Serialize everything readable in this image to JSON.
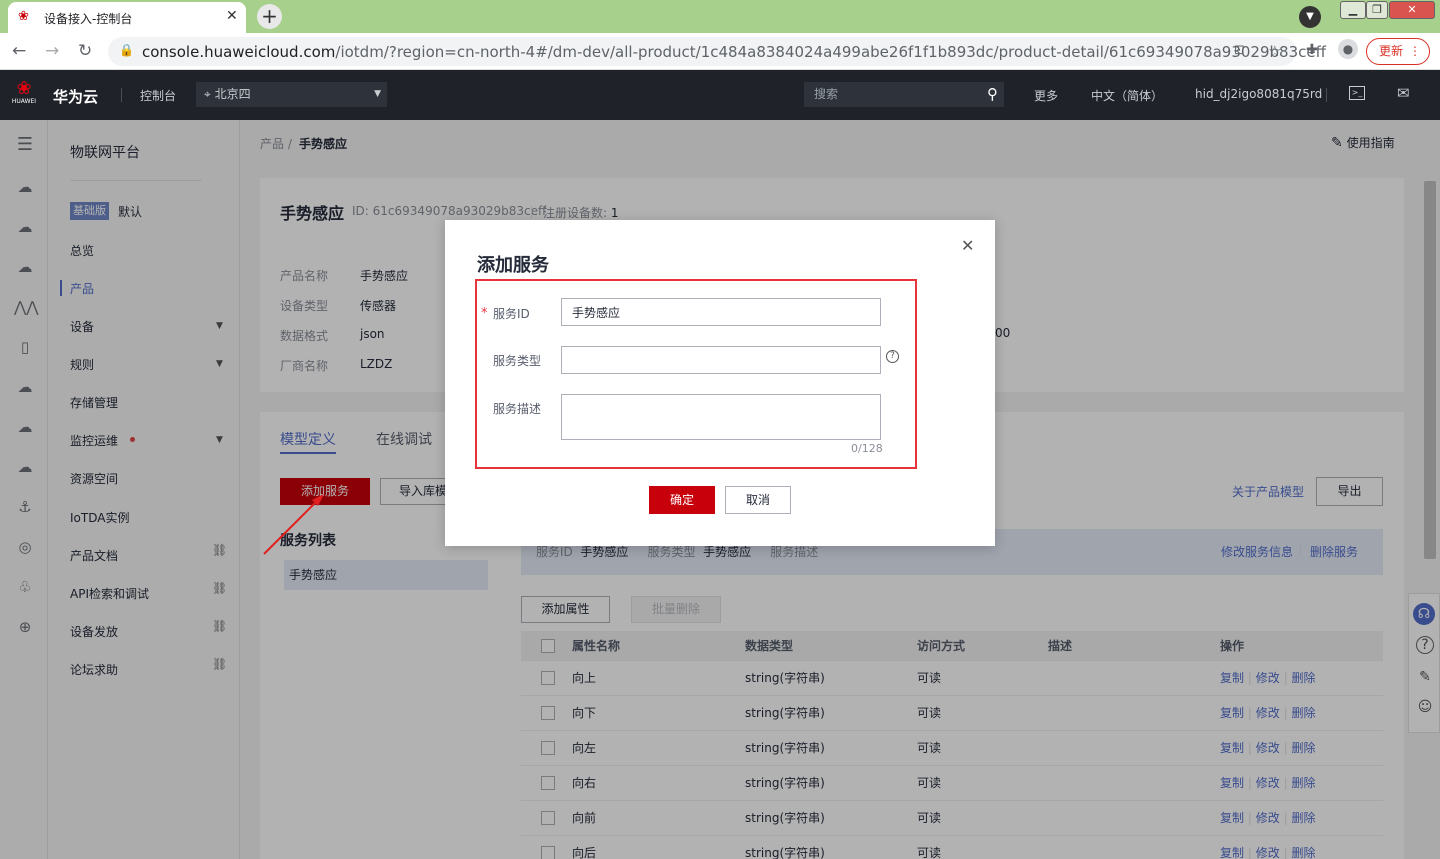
{
  "browser": {
    "tab_title": "设备接入-控制台",
    "url_host": "console.huaweicloud.com",
    "url_path": "/iotdm/?region=cn-north-4#/dm-dev/all-product/1c484a8384024a499abe26f1f1b893dc/product-detail/61c69349078a93029b83ceff",
    "update_label": "更新"
  },
  "topnav": {
    "logo_text": "HUAWEI",
    "brand": "华为云",
    "console": "控制台",
    "region": "北京四",
    "search_placeholder": "搜索",
    "more": "更多",
    "language": "中文（简体）",
    "user": "hid_dj2igo8081q75rd"
  },
  "sidebar": {
    "title": "物联网平台",
    "edition_badge": "基础版",
    "edition_name": "默认",
    "items": [
      {
        "label": "总览"
      },
      {
        "label": "产品"
      },
      {
        "label": "设备"
      },
      {
        "label": "规则"
      },
      {
        "label": "存储管理"
      },
      {
        "label": "监控运维"
      },
      {
        "label": "资源空间"
      },
      {
        "label": "IoTDA实例"
      },
      {
        "label": "产品文档"
      },
      {
        "label": "API检索和调试"
      },
      {
        "label": "设备发放"
      },
      {
        "label": "论坛求助"
      }
    ]
  },
  "breadcrumb": {
    "parent": "产品",
    "sep": "/",
    "current": "手势感应"
  },
  "guide": "使用指南",
  "product": {
    "name": "手势感应",
    "id_label": "ID:",
    "id": "61c69349078a93029b83ceff",
    "registered_label": "注册设备数:",
    "registered": "1",
    "fields": [
      {
        "key": "产品名称",
        "value": "手势感应"
      },
      {
        "key": "设备类型",
        "value": "传感器"
      },
      {
        "key": "数据格式",
        "value": "json"
      },
      {
        "key": "厂商名称",
        "value": "LZDZ"
      }
    ],
    "partial_value": "00"
  },
  "tabs": {
    "model": "模型定义",
    "debug": "在线调试"
  },
  "actions": {
    "add_service": "添加服务",
    "import": "导入库模型",
    "about": "关于产品模型",
    "export": "导出"
  },
  "service_list": {
    "title": "服务列表",
    "items": [
      "手势感应"
    ]
  },
  "service_bar": {
    "id_label": "服务ID",
    "id": "手势感应",
    "type_label": "服务类型",
    "type": "手势感应",
    "desc_label": "服务描述",
    "edit": "修改服务信息",
    "delete": "删除服务"
  },
  "props": {
    "add": "添加属性",
    "batch_delete": "批量删除",
    "columns": [
      "属性名称",
      "数据类型",
      "访问方式",
      "描述",
      "操作"
    ],
    "ops": [
      "复制",
      "修改",
      "删除"
    ],
    "rows": [
      {
        "name": "向上",
        "type": "string(字符串)",
        "access": "可读"
      },
      {
        "name": "向下",
        "type": "string(字符串)",
        "access": "可读"
      },
      {
        "name": "向左",
        "type": "string(字符串)",
        "access": "可读"
      },
      {
        "name": "向右",
        "type": "string(字符串)",
        "access": "可读"
      },
      {
        "name": "向前",
        "type": "string(字符串)",
        "access": "可读"
      },
      {
        "name": "向后",
        "type": "string(字符串)",
        "access": "可读"
      }
    ]
  },
  "dialog": {
    "title": "添加服务",
    "required_mark": "*",
    "service_id_label": "服务ID",
    "service_id_value": "手势感应",
    "service_type_label": "服务类型",
    "service_type_value": "",
    "service_desc_label": "服务描述",
    "service_desc_value": "",
    "counter": "0/128",
    "ok": "确定",
    "cancel": "取消"
  },
  "colors": {
    "brand_red": "#c7000b",
    "link_blue": "#526ecc",
    "highlight_red": "#e5343b"
  }
}
